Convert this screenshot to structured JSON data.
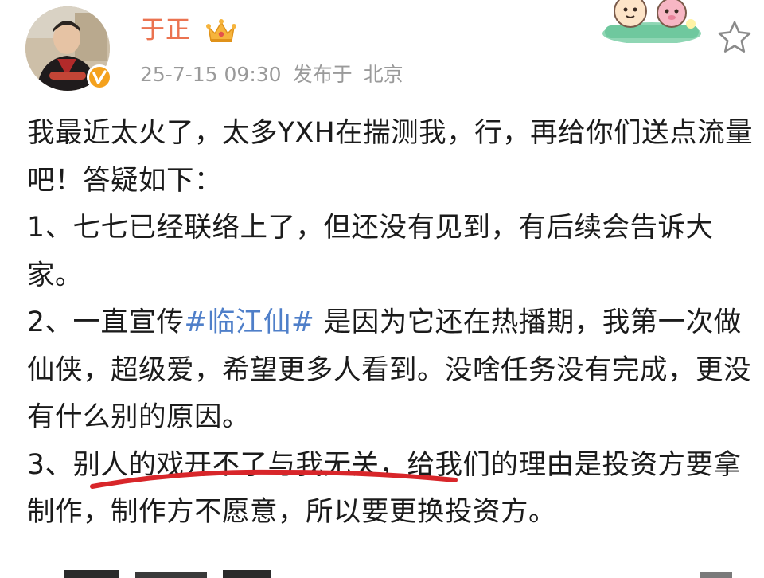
{
  "author": {
    "name": "于正",
    "verified": true
  },
  "meta": {
    "timestamp": "25-7-15 09:30",
    "publish_label": "发布于",
    "location": "北京"
  },
  "colors": {
    "username": "#eb7350",
    "hashtag": "#4f7fc9",
    "meta": "#9a9a9a",
    "underline": "#d8262a",
    "badge": "#f4a11d"
  },
  "icons": {
    "verified": "verified-badge-icon",
    "crown": "crown-icon",
    "favorite": "star-icon"
  },
  "post": {
    "line1": "我最近太火了，太多YXH在揣测我，行，再给你们送点流量吧！答疑如下：",
    "item1": "1、七七已经联络上了，但还没有见到，有后续会告诉大家。",
    "item2_before": "2、一直宣传",
    "item2_hashtag": "#临江仙#",
    "item2_after": " 是因为它还在热播期，我第一次做仙侠，超级爱，希望更多人看到。没啥任务没有完成，更没有什么别的原因。",
    "item3_prefix": "3、",
    "item3_highlight": "别人的戏开不了与我无关",
    "item3_rest": "，给我们的理由是投资方要拿制作，制作方不愿意，所以要更换投资方。"
  }
}
